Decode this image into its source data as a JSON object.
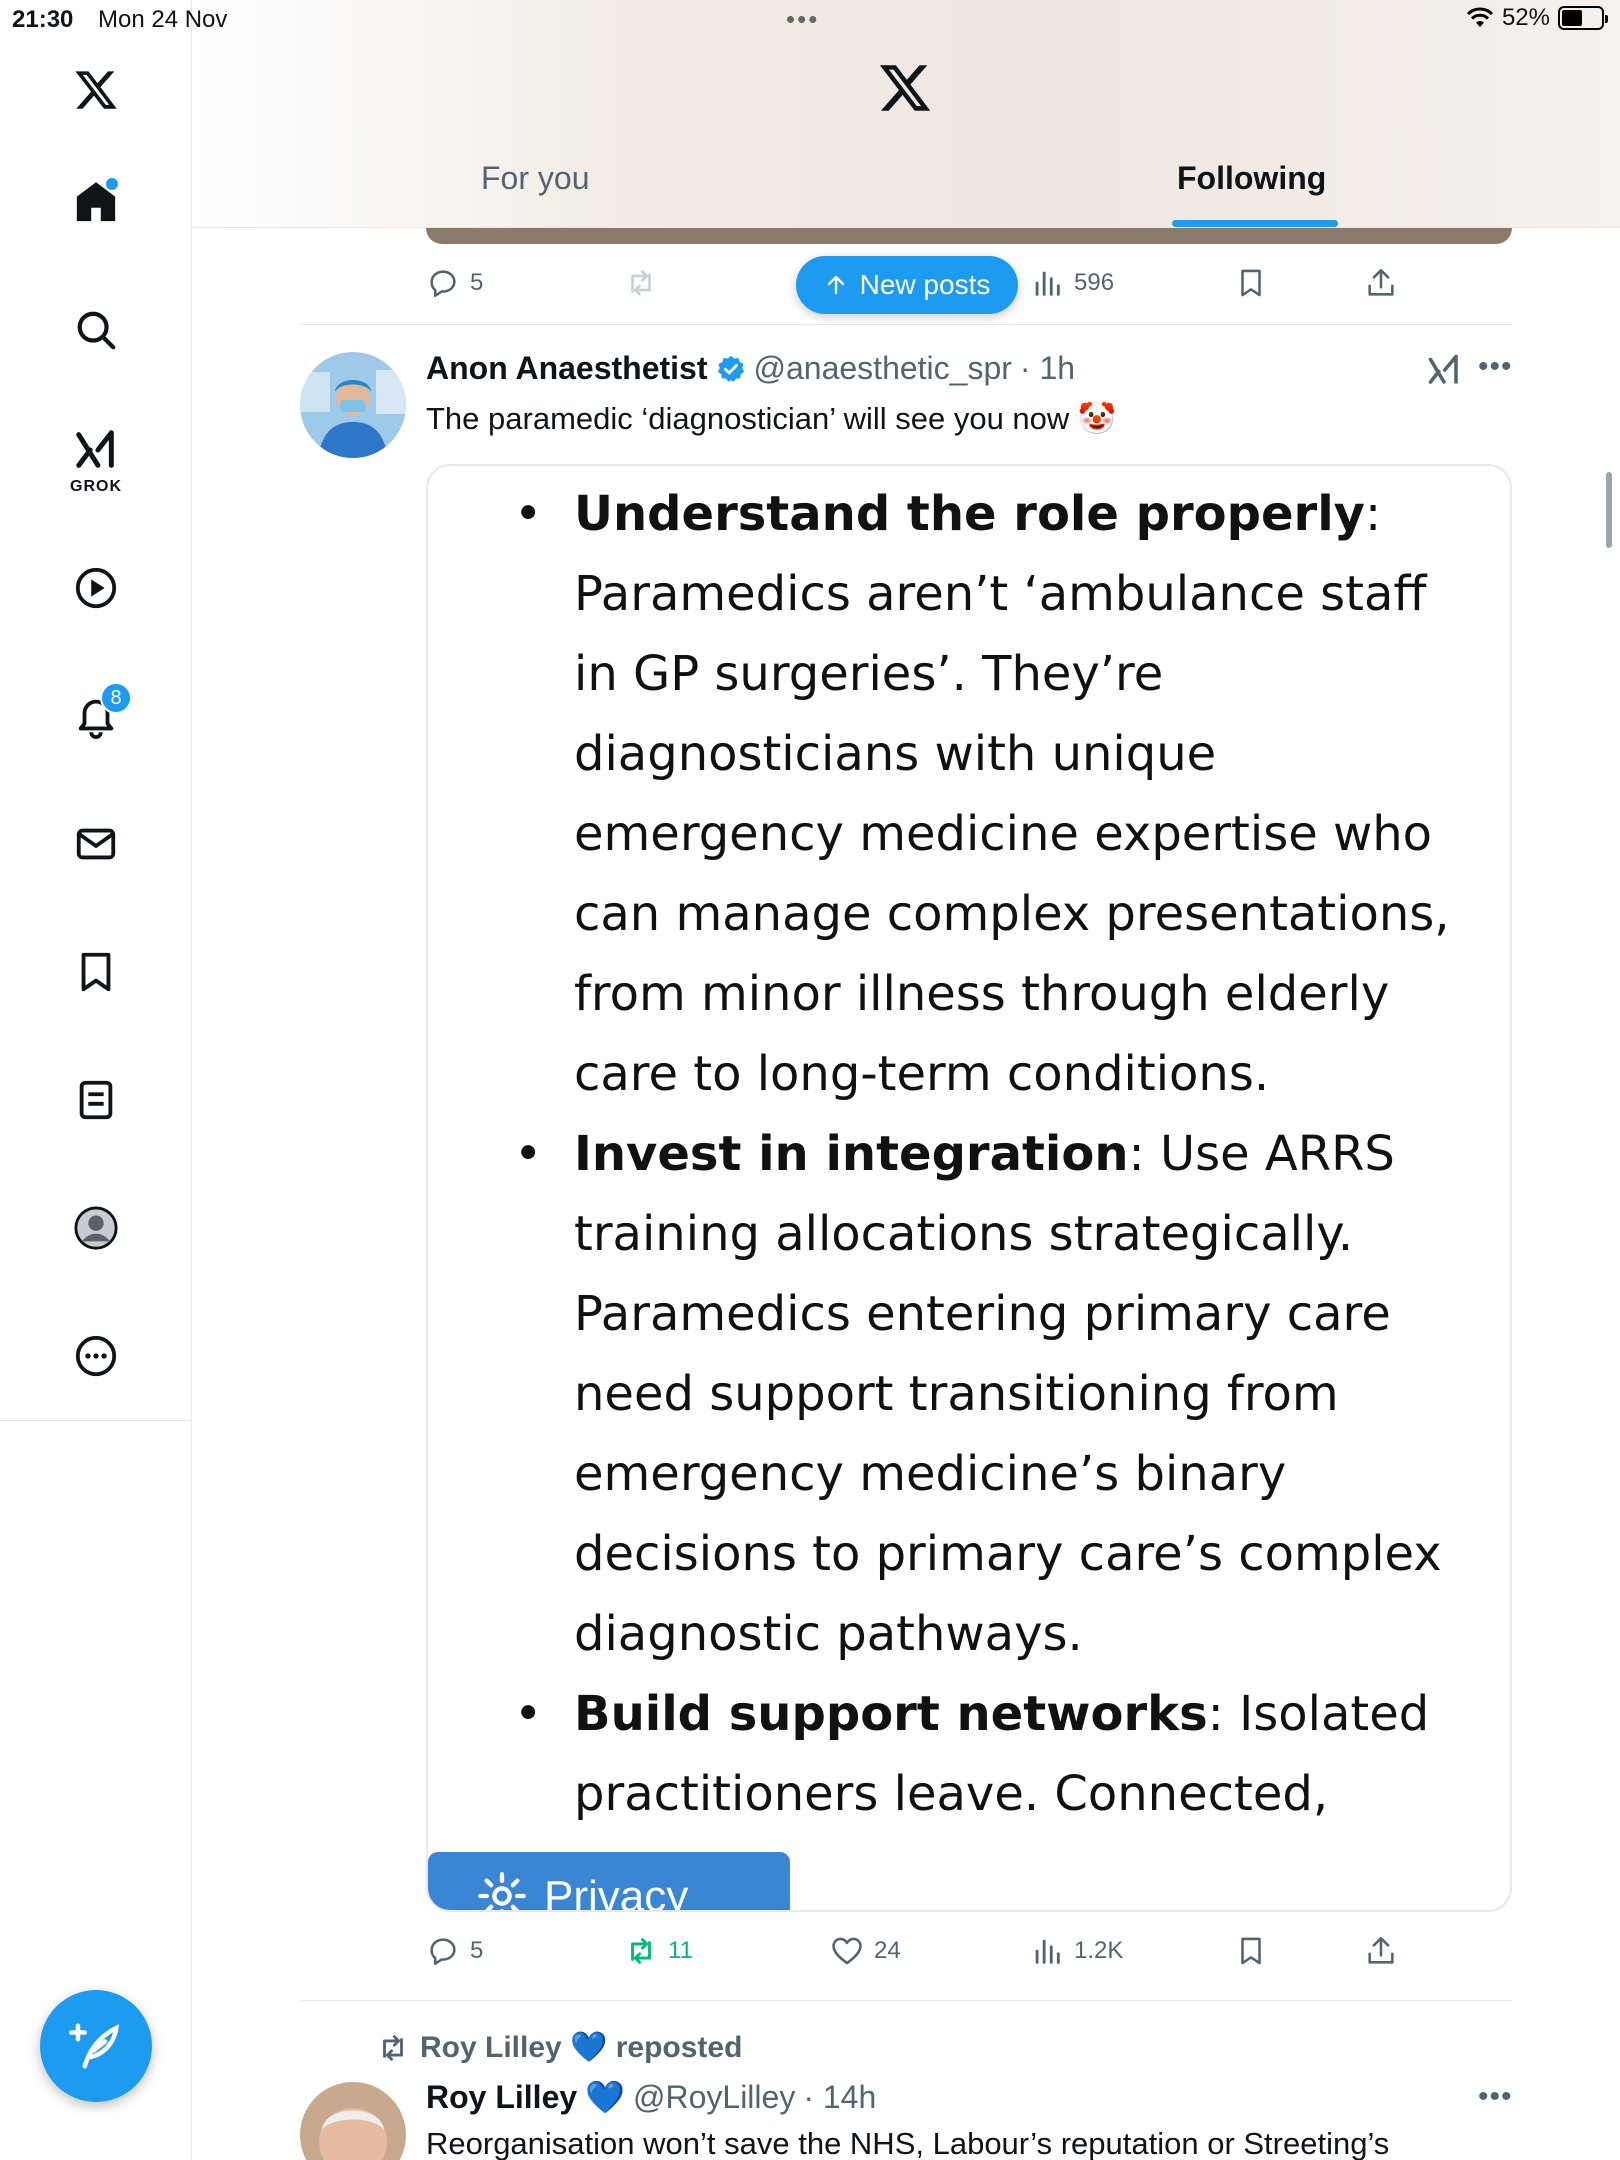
{
  "status_bar": {
    "time": "21:30",
    "date": "Mon 24 Nov",
    "battery": "52%",
    "battery_level": 0.52
  },
  "sidebar": {
    "grok_label": "GROK",
    "notifications_count": "8",
    "items": [
      "home-icon",
      "search-icon",
      "grok-icon",
      "video-icon",
      "bell-icon",
      "mail-icon",
      "bookmark-icon",
      "lists-icon",
      "profile-icon",
      "more-icon"
    ]
  },
  "header": {
    "tabs": [
      {
        "label": "For you",
        "selected": false
      },
      {
        "label": "Following",
        "selected": true
      }
    ]
  },
  "new_posts": {
    "label": "New posts"
  },
  "previous_tweet": {
    "replies": "5",
    "views": "596"
  },
  "tweet": {
    "name": "Anon Anaesthetist",
    "verified": true,
    "handle": "@anaesthetic_spr",
    "time": "· 1h",
    "text": "The paramedic ‘diagnostician’ will see you now 🤡",
    "image_bullets": [
      {
        "bold": "Understand the role properly",
        "rest": ": Paramedics aren’t ‘ambulance staff in GP surgeries’. They’re diagnosticians with unique emergency medicine expertise who can manage complex presentations, from minor illness through elderly care to long-term conditions."
      },
      {
        "bold": "Invest in integration",
        "rest": ": Use ARRS training allocations strategically. Paramedics entering primary care need support transitioning from emergency medicine’s binary decisions to primary care’s complex diagnostic pathways."
      },
      {
        "bold": "Build support networks",
        "rest": ": Isolated practitioners leave. Connected,"
      }
    ],
    "privacy_label": "Privacy",
    "replies": "5",
    "reposts": "11",
    "likes": "24",
    "views": "1.2K"
  },
  "next_tweet": {
    "reposted_by": "Roy Lilley 💙 reposted",
    "name": "Roy Lilley",
    "badge": "💙",
    "handle": "@RoyLilley",
    "time": "· 14h",
    "text": "Reorganisation won’t save the NHS, Labour’s reputation or Streeting’s"
  },
  "colors": {
    "accent": "#1d9bf0",
    "repost_green": "#00ba7c",
    "muted": "#536471"
  }
}
